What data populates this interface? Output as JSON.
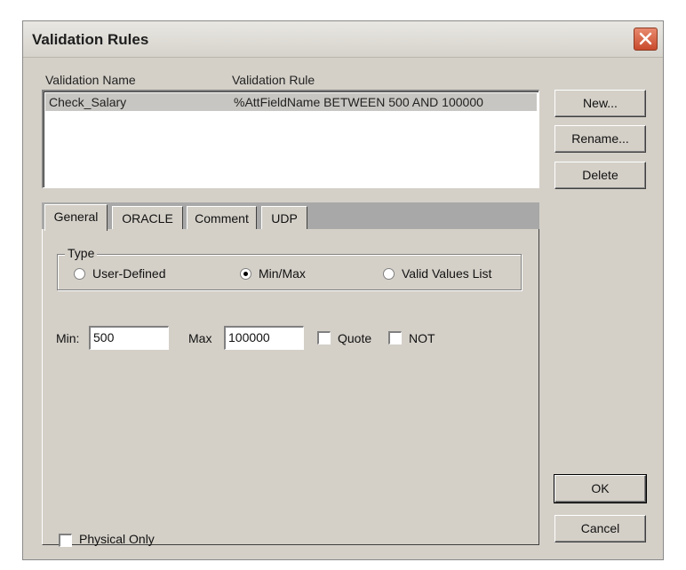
{
  "window": {
    "title": "Validation Rules"
  },
  "list": {
    "columns": [
      "Validation Name",
      "Validation Rule"
    ],
    "rows": [
      {
        "name": "Check_Salary",
        "rule": "%AttFieldName BETWEEN 500 AND 100000"
      }
    ]
  },
  "side_buttons": {
    "new": "New...",
    "rename": "Rename...",
    "delete": "Delete"
  },
  "tabs": [
    "General",
    "ORACLE",
    "Comment",
    "UDP"
  ],
  "active_tab": "General",
  "general": {
    "type_label": "Type",
    "type_options": [
      "User-Defined",
      "Min/Max",
      "Valid Values List"
    ],
    "type_selected": "Min/Max",
    "min_label": "Min:",
    "min_value": "500",
    "max_label": "Max",
    "max_value": "100000",
    "quote_label": "Quote",
    "quote_checked": false,
    "not_label": "NOT",
    "not_checked": false,
    "physical_only_label": "Physical Only",
    "physical_only_checked": false
  },
  "footer_buttons": {
    "ok": "OK",
    "cancel": "Cancel"
  }
}
